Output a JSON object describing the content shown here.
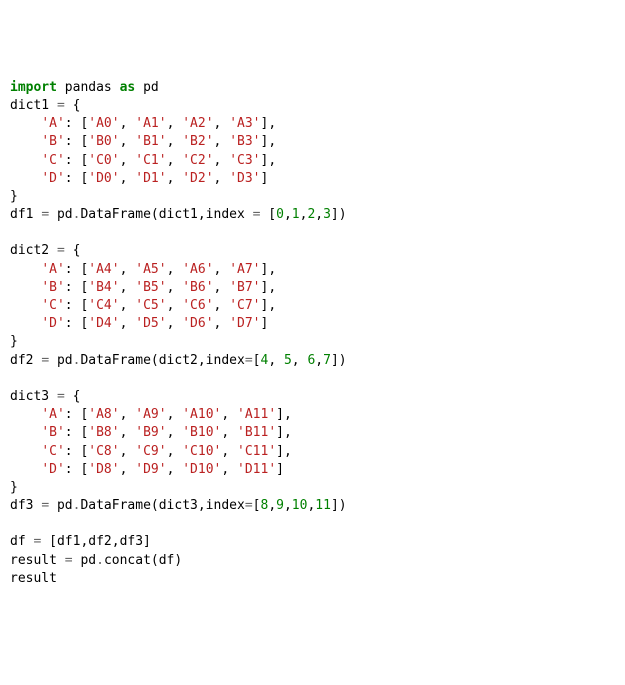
{
  "lines": [
    [
      {
        "cls": "kw",
        "t": "import"
      },
      {
        "cls": "nm",
        "t": " pandas "
      },
      {
        "cls": "kw",
        "t": "as"
      },
      {
        "cls": "nm",
        "t": " pd"
      }
    ],
    [
      {
        "cls": "nm",
        "t": "dict1 "
      },
      {
        "cls": "op",
        "t": "="
      },
      {
        "cls": "nm",
        "t": " {"
      }
    ],
    [
      {
        "cls": "nm",
        "t": "    "
      },
      {
        "cls": "str",
        "t": "'A'"
      },
      {
        "cls": "nm",
        "t": ": ["
      },
      {
        "cls": "str",
        "t": "'A0'"
      },
      {
        "cls": "nm",
        "t": ", "
      },
      {
        "cls": "str",
        "t": "'A1'"
      },
      {
        "cls": "nm",
        "t": ", "
      },
      {
        "cls": "str",
        "t": "'A2'"
      },
      {
        "cls": "nm",
        "t": ", "
      },
      {
        "cls": "str",
        "t": "'A3'"
      },
      {
        "cls": "nm",
        "t": "],"
      }
    ],
    [
      {
        "cls": "nm",
        "t": "    "
      },
      {
        "cls": "str",
        "t": "'B'"
      },
      {
        "cls": "nm",
        "t": ": ["
      },
      {
        "cls": "str",
        "t": "'B0'"
      },
      {
        "cls": "nm",
        "t": ", "
      },
      {
        "cls": "str",
        "t": "'B1'"
      },
      {
        "cls": "nm",
        "t": ", "
      },
      {
        "cls": "str",
        "t": "'B2'"
      },
      {
        "cls": "nm",
        "t": ", "
      },
      {
        "cls": "str",
        "t": "'B3'"
      },
      {
        "cls": "nm",
        "t": "],"
      }
    ],
    [
      {
        "cls": "nm",
        "t": "    "
      },
      {
        "cls": "str",
        "t": "'C'"
      },
      {
        "cls": "nm",
        "t": ": ["
      },
      {
        "cls": "str",
        "t": "'C0'"
      },
      {
        "cls": "nm",
        "t": ", "
      },
      {
        "cls": "str",
        "t": "'C1'"
      },
      {
        "cls": "nm",
        "t": ", "
      },
      {
        "cls": "str",
        "t": "'C2'"
      },
      {
        "cls": "nm",
        "t": ", "
      },
      {
        "cls": "str",
        "t": "'C3'"
      },
      {
        "cls": "nm",
        "t": "],"
      }
    ],
    [
      {
        "cls": "nm",
        "t": "    "
      },
      {
        "cls": "str",
        "t": "'D'"
      },
      {
        "cls": "nm",
        "t": ": ["
      },
      {
        "cls": "str",
        "t": "'D0'"
      },
      {
        "cls": "nm",
        "t": ", "
      },
      {
        "cls": "str",
        "t": "'D1'"
      },
      {
        "cls": "nm",
        "t": ", "
      },
      {
        "cls": "str",
        "t": "'D2'"
      },
      {
        "cls": "nm",
        "t": ", "
      },
      {
        "cls": "str",
        "t": "'D3'"
      },
      {
        "cls": "nm",
        "t": "]"
      }
    ],
    [
      {
        "cls": "nm",
        "t": "}"
      }
    ],
    [
      {
        "cls": "nm",
        "t": "df1 "
      },
      {
        "cls": "op",
        "t": "="
      },
      {
        "cls": "nm",
        "t": " pd"
      },
      {
        "cls": "op",
        "t": "."
      },
      {
        "cls": "nm",
        "t": "DataFrame(dict1,index "
      },
      {
        "cls": "op",
        "t": "="
      },
      {
        "cls": "nm",
        "t": " ["
      },
      {
        "cls": "num",
        "t": "0"
      },
      {
        "cls": "nm",
        "t": ","
      },
      {
        "cls": "num",
        "t": "1"
      },
      {
        "cls": "nm",
        "t": ","
      },
      {
        "cls": "num",
        "t": "2"
      },
      {
        "cls": "nm",
        "t": ","
      },
      {
        "cls": "num",
        "t": "3"
      },
      {
        "cls": "nm",
        "t": "])"
      }
    ],
    [
      {
        "cls": "nm",
        "t": ""
      }
    ],
    [
      {
        "cls": "nm",
        "t": "dict2 "
      },
      {
        "cls": "op",
        "t": "="
      },
      {
        "cls": "nm",
        "t": " {"
      }
    ],
    [
      {
        "cls": "nm",
        "t": "    "
      },
      {
        "cls": "str",
        "t": "'A'"
      },
      {
        "cls": "nm",
        "t": ": ["
      },
      {
        "cls": "str",
        "t": "'A4'"
      },
      {
        "cls": "nm",
        "t": ", "
      },
      {
        "cls": "str",
        "t": "'A5'"
      },
      {
        "cls": "nm",
        "t": ", "
      },
      {
        "cls": "str",
        "t": "'A6'"
      },
      {
        "cls": "nm",
        "t": ", "
      },
      {
        "cls": "str",
        "t": "'A7'"
      },
      {
        "cls": "nm",
        "t": "],"
      }
    ],
    [
      {
        "cls": "nm",
        "t": "    "
      },
      {
        "cls": "str",
        "t": "'B'"
      },
      {
        "cls": "nm",
        "t": ": ["
      },
      {
        "cls": "str",
        "t": "'B4'"
      },
      {
        "cls": "nm",
        "t": ", "
      },
      {
        "cls": "str",
        "t": "'B5'"
      },
      {
        "cls": "nm",
        "t": ", "
      },
      {
        "cls": "str",
        "t": "'B6'"
      },
      {
        "cls": "nm",
        "t": ", "
      },
      {
        "cls": "str",
        "t": "'B7'"
      },
      {
        "cls": "nm",
        "t": "],"
      }
    ],
    [
      {
        "cls": "nm",
        "t": "    "
      },
      {
        "cls": "str",
        "t": "'C'"
      },
      {
        "cls": "nm",
        "t": ": ["
      },
      {
        "cls": "str",
        "t": "'C4'"
      },
      {
        "cls": "nm",
        "t": ", "
      },
      {
        "cls": "str",
        "t": "'C5'"
      },
      {
        "cls": "nm",
        "t": ", "
      },
      {
        "cls": "str",
        "t": "'C6'"
      },
      {
        "cls": "nm",
        "t": ", "
      },
      {
        "cls": "str",
        "t": "'C7'"
      },
      {
        "cls": "nm",
        "t": "],"
      }
    ],
    [
      {
        "cls": "nm",
        "t": "    "
      },
      {
        "cls": "str",
        "t": "'D'"
      },
      {
        "cls": "nm",
        "t": ": ["
      },
      {
        "cls": "str",
        "t": "'D4'"
      },
      {
        "cls": "nm",
        "t": ", "
      },
      {
        "cls": "str",
        "t": "'D5'"
      },
      {
        "cls": "nm",
        "t": ", "
      },
      {
        "cls": "str",
        "t": "'D6'"
      },
      {
        "cls": "nm",
        "t": ", "
      },
      {
        "cls": "str",
        "t": "'D7'"
      },
      {
        "cls": "nm",
        "t": "]"
      }
    ],
    [
      {
        "cls": "nm",
        "t": "}"
      }
    ],
    [
      {
        "cls": "nm",
        "t": "df2 "
      },
      {
        "cls": "op",
        "t": "="
      },
      {
        "cls": "nm",
        "t": " pd"
      },
      {
        "cls": "op",
        "t": "."
      },
      {
        "cls": "nm",
        "t": "DataFrame(dict2,index"
      },
      {
        "cls": "op",
        "t": "="
      },
      {
        "cls": "nm",
        "t": "["
      },
      {
        "cls": "num",
        "t": "4"
      },
      {
        "cls": "nm",
        "t": ", "
      },
      {
        "cls": "num",
        "t": "5"
      },
      {
        "cls": "nm",
        "t": ", "
      },
      {
        "cls": "num",
        "t": "6"
      },
      {
        "cls": "nm",
        "t": ","
      },
      {
        "cls": "num",
        "t": "7"
      },
      {
        "cls": "nm",
        "t": "])"
      }
    ],
    [
      {
        "cls": "nm",
        "t": ""
      }
    ],
    [
      {
        "cls": "nm",
        "t": "dict3 "
      },
      {
        "cls": "op",
        "t": "="
      },
      {
        "cls": "nm",
        "t": " {"
      }
    ],
    [
      {
        "cls": "nm",
        "t": "    "
      },
      {
        "cls": "str",
        "t": "'A'"
      },
      {
        "cls": "nm",
        "t": ": ["
      },
      {
        "cls": "str",
        "t": "'A8'"
      },
      {
        "cls": "nm",
        "t": ", "
      },
      {
        "cls": "str",
        "t": "'A9'"
      },
      {
        "cls": "nm",
        "t": ", "
      },
      {
        "cls": "str",
        "t": "'A10'"
      },
      {
        "cls": "nm",
        "t": ", "
      },
      {
        "cls": "str",
        "t": "'A11'"
      },
      {
        "cls": "nm",
        "t": "],"
      }
    ],
    [
      {
        "cls": "nm",
        "t": "    "
      },
      {
        "cls": "str",
        "t": "'B'"
      },
      {
        "cls": "nm",
        "t": ": ["
      },
      {
        "cls": "str",
        "t": "'B8'"
      },
      {
        "cls": "nm",
        "t": ", "
      },
      {
        "cls": "str",
        "t": "'B9'"
      },
      {
        "cls": "nm",
        "t": ", "
      },
      {
        "cls": "str",
        "t": "'B10'"
      },
      {
        "cls": "nm",
        "t": ", "
      },
      {
        "cls": "str",
        "t": "'B11'"
      },
      {
        "cls": "nm",
        "t": "],"
      }
    ],
    [
      {
        "cls": "nm",
        "t": "    "
      },
      {
        "cls": "str",
        "t": "'C'"
      },
      {
        "cls": "nm",
        "t": ": ["
      },
      {
        "cls": "str",
        "t": "'C8'"
      },
      {
        "cls": "nm",
        "t": ", "
      },
      {
        "cls": "str",
        "t": "'C9'"
      },
      {
        "cls": "nm",
        "t": ", "
      },
      {
        "cls": "str",
        "t": "'C10'"
      },
      {
        "cls": "nm",
        "t": ", "
      },
      {
        "cls": "str",
        "t": "'C11'"
      },
      {
        "cls": "nm",
        "t": "],"
      }
    ],
    [
      {
        "cls": "nm",
        "t": "    "
      },
      {
        "cls": "str",
        "t": "'D'"
      },
      {
        "cls": "nm",
        "t": ": ["
      },
      {
        "cls": "str",
        "t": "'D8'"
      },
      {
        "cls": "nm",
        "t": ", "
      },
      {
        "cls": "str",
        "t": "'D9'"
      },
      {
        "cls": "nm",
        "t": ", "
      },
      {
        "cls": "str",
        "t": "'D10'"
      },
      {
        "cls": "nm",
        "t": ", "
      },
      {
        "cls": "str",
        "t": "'D11'"
      },
      {
        "cls": "nm",
        "t": "]"
      }
    ],
    [
      {
        "cls": "nm",
        "t": "}"
      }
    ],
    [
      {
        "cls": "nm",
        "t": "df3 "
      },
      {
        "cls": "op",
        "t": "="
      },
      {
        "cls": "nm",
        "t": " pd"
      },
      {
        "cls": "op",
        "t": "."
      },
      {
        "cls": "nm",
        "t": "DataFrame(dict3,index"
      },
      {
        "cls": "op",
        "t": "="
      },
      {
        "cls": "nm",
        "t": "["
      },
      {
        "cls": "num",
        "t": "8"
      },
      {
        "cls": "nm",
        "t": ","
      },
      {
        "cls": "num",
        "t": "9"
      },
      {
        "cls": "nm",
        "t": ","
      },
      {
        "cls": "num",
        "t": "10"
      },
      {
        "cls": "nm",
        "t": ","
      },
      {
        "cls": "num",
        "t": "11"
      },
      {
        "cls": "nm",
        "t": "])"
      }
    ],
    [
      {
        "cls": "nm",
        "t": ""
      }
    ],
    [
      {
        "cls": "nm",
        "t": "df "
      },
      {
        "cls": "op",
        "t": "="
      },
      {
        "cls": "nm",
        "t": " [df1,df2,df3]"
      }
    ],
    [
      {
        "cls": "nm",
        "t": "result "
      },
      {
        "cls": "op",
        "t": "="
      },
      {
        "cls": "nm",
        "t": " pd"
      },
      {
        "cls": "op",
        "t": "."
      },
      {
        "cls": "nm",
        "t": "concat(df)"
      }
    ],
    [
      {
        "cls": "nm",
        "t": "result"
      }
    ]
  ]
}
